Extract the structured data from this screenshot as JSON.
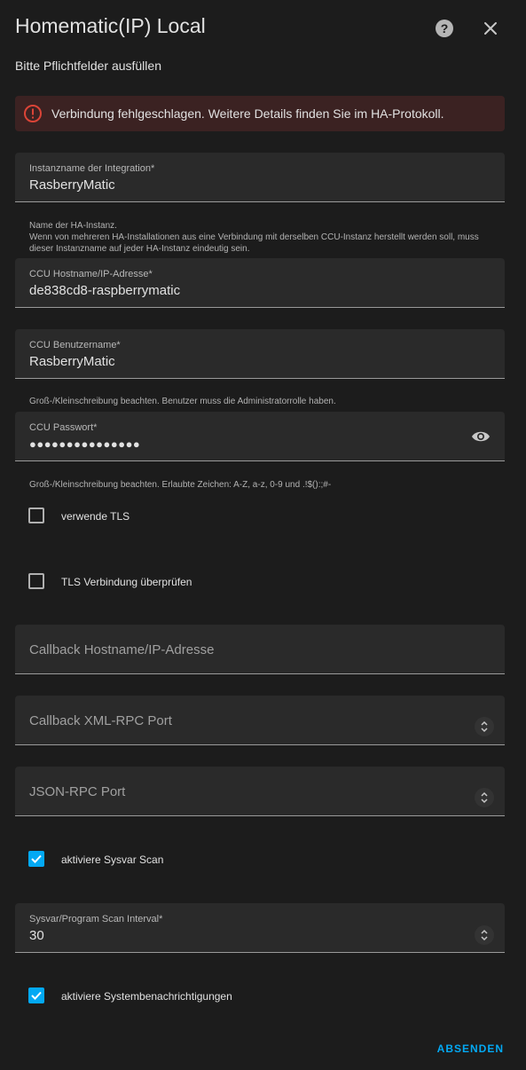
{
  "header": {
    "title": "Homematic(IP) Local",
    "subtitle": "Bitte Pflichtfelder ausfüllen"
  },
  "alert": {
    "text": "Verbindung fehlgeschlagen. Weitere Details finden Sie im HA-Protokoll."
  },
  "fields": {
    "instance": {
      "label": "Instanzname der Integration*",
      "value": "RasberryMatic",
      "helper_line1": "Name der HA-Instanz.",
      "helper_line2": "Wenn von mehreren HA-Installationen aus eine Verbindung mit derselben CCU-Instanz herstellt werden soll, muss dieser Instanzname auf jeder HA-Instanz eindeutig sein."
    },
    "host": {
      "label": "CCU Hostname/IP-Adresse*",
      "value": "de838cd8-raspberrymatic"
    },
    "username": {
      "label": "CCU Benutzername*",
      "value": "RasberryMatic",
      "helper": "Groß-/Kleinschreibung beachten. Benutzer muss die Administratorrolle haben."
    },
    "password": {
      "label": "CCU Passwort*",
      "value": "●●●●●●●●●●●●●●●",
      "helper": "Groß-/Kleinschreibung beachten. Erlaubte Zeichen: A-Z, a-z, 0-9 und .!$():;#-"
    },
    "callback_host": {
      "placeholder": "Callback Hostname/IP-Adresse"
    },
    "callback_port": {
      "placeholder": "Callback XML-RPC Port"
    },
    "json_port": {
      "placeholder": "JSON-RPC Port"
    },
    "scan_interval": {
      "label": "Sysvar/Program Scan Interval*",
      "value": "30"
    }
  },
  "checkboxes": {
    "tls": {
      "label": "verwende TLS",
      "checked": false
    },
    "verify_tls": {
      "label": "TLS Verbindung überprüfen",
      "checked": false
    },
    "sysvar_scan": {
      "label": "aktiviere Sysvar Scan",
      "checked": true
    },
    "notifications": {
      "label": "aktiviere Systembenachrichtigungen",
      "checked": true
    }
  },
  "actions": {
    "submit_label": "ABSENDEN"
  },
  "colors": {
    "accent": "#03a9f4",
    "error": "#db4437",
    "alert_bg": "#3b2222"
  }
}
